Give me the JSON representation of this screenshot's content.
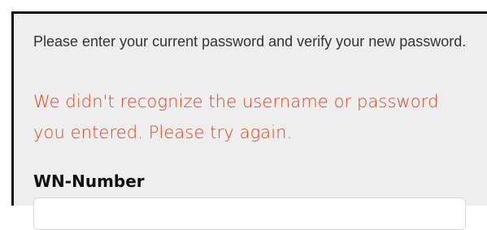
{
  "form": {
    "instructions": "Please enter your current password and verify your new password.",
    "error_message": "We didn't recognize the username or password you entered. Please try again.",
    "wn_number": {
      "label": "WN-Number",
      "value": "",
      "placeholder": ""
    }
  },
  "colors": {
    "panel_background": "#eeeeee",
    "error_text": "#e0431c",
    "label_text": "#111111",
    "instruction_text": "#333333"
  }
}
